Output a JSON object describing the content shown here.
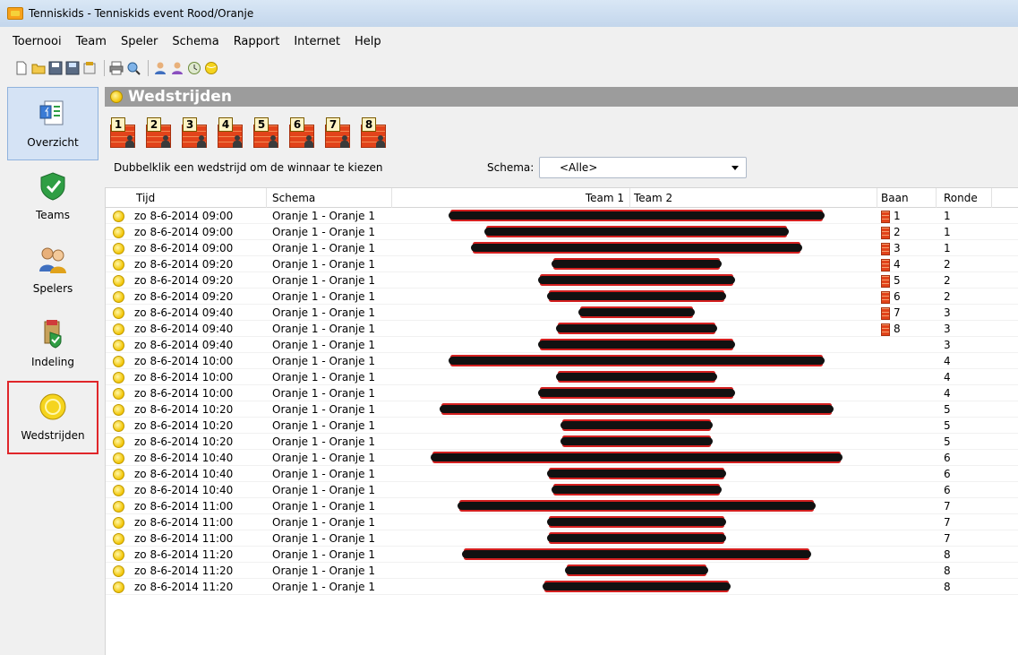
{
  "window": {
    "title": "Tenniskids - Tenniskids event Rood/Oranje"
  },
  "menu": [
    {
      "label": "Toernooi"
    },
    {
      "label": "Team"
    },
    {
      "label": "Speler"
    },
    {
      "label": "Schema"
    },
    {
      "label": "Rapport"
    },
    {
      "label": "Internet"
    },
    {
      "label": "Help"
    }
  ],
  "sidebar": {
    "items": [
      {
        "label": "Overzicht",
        "icon": "overview-icon",
        "active": true
      },
      {
        "label": "Teams",
        "icon": "shield-icon",
        "active": false
      },
      {
        "label": "Spelers",
        "icon": "players-icon",
        "active": false
      },
      {
        "label": "Indeling",
        "icon": "indeling-icon",
        "active": false
      },
      {
        "label": "Wedstrijden",
        "icon": "ball-icon",
        "active": false,
        "highlighted": true
      }
    ]
  },
  "panel": {
    "title": "Wedstrijden",
    "courts": [
      "1",
      "2",
      "3",
      "4",
      "5",
      "6",
      "7",
      "8"
    ],
    "hint": "Dubbelklik een wedstrijd om de winnaar te kiezen",
    "schema_label": "Schema:",
    "schema_value": "<Alle>"
  },
  "table": {
    "headers": {
      "tijd": "Tijd",
      "schema": "Schema",
      "team1": "Team 1",
      "team2": "Team 2",
      "baan": "Baan",
      "ronde": "Ronde"
    },
    "rows": [
      {
        "tijd": "zo 8-6-2014 09:00",
        "schema": "Oranje 1 - Oranje 1",
        "baan": "1",
        "ronde": "1",
        "redact_w": 420
      },
      {
        "tijd": "zo 8-6-2014 09:00",
        "schema": "Oranje 1 - Oranje 1",
        "baan": "2",
        "ronde": "1",
        "redact_w": 340
      },
      {
        "tijd": "zo 8-6-2014 09:00",
        "schema": "Oranje 1 - Oranje 1",
        "baan": "3",
        "ronde": "1",
        "redact_w": 370
      },
      {
        "tijd": "zo 8-6-2014 09:20",
        "schema": "Oranje 1 - Oranje 1",
        "baan": "4",
        "ronde": "2",
        "redact_w": 190
      },
      {
        "tijd": "zo 8-6-2014 09:20",
        "schema": "Oranje 1 - Oranje 1",
        "baan": "5",
        "ronde": "2",
        "redact_w": 220
      },
      {
        "tijd": "zo 8-6-2014 09:20",
        "schema": "Oranje 1 - Oranje 1",
        "baan": "6",
        "ronde": "2",
        "redact_w": 200
      },
      {
        "tijd": "zo 8-6-2014 09:40",
        "schema": "Oranje 1 - Oranje 1",
        "baan": "7",
        "ronde": "3",
        "redact_w": 130
      },
      {
        "tijd": "zo 8-6-2014 09:40",
        "schema": "Oranje 1 - Oranje 1",
        "baan": "8",
        "ronde": "3",
        "redact_w": 180
      },
      {
        "tijd": "zo 8-6-2014 09:40",
        "schema": "Oranje 1 - Oranje 1",
        "baan": "",
        "ronde": "3",
        "redact_w": 220
      },
      {
        "tijd": "zo 8-6-2014 10:00",
        "schema": "Oranje 1 - Oranje 1",
        "baan": "",
        "ronde": "4",
        "redact_w": 420
      },
      {
        "tijd": "zo 8-6-2014 10:00",
        "schema": "Oranje 1 - Oranje 1",
        "baan": "",
        "ronde": "4",
        "redact_w": 180
      },
      {
        "tijd": "zo 8-6-2014 10:00",
        "schema": "Oranje 1 - Oranje 1",
        "baan": "",
        "ronde": "4",
        "redact_w": 220
      },
      {
        "tijd": "zo 8-6-2014 10:20",
        "schema": "Oranje 1 - Oranje 1",
        "baan": "",
        "ronde": "5",
        "redact_w": 440
      },
      {
        "tijd": "zo 8-6-2014 10:20",
        "schema": "Oranje 1 - Oranje 1",
        "baan": "",
        "ronde": "5",
        "redact_w": 170
      },
      {
        "tijd": "zo 8-6-2014 10:20",
        "schema": "Oranje 1 - Oranje 1",
        "baan": "",
        "ronde": "5",
        "redact_w": 170
      },
      {
        "tijd": "zo 8-6-2014 10:40",
        "schema": "Oranje 1 - Oranje 1",
        "baan": "",
        "ronde": "6",
        "redact_w": 460
      },
      {
        "tijd": "zo 8-6-2014 10:40",
        "schema": "Oranje 1 - Oranje 1",
        "baan": "",
        "ronde": "6",
        "redact_w": 200
      },
      {
        "tijd": "zo 8-6-2014 10:40",
        "schema": "Oranje 1 - Oranje 1",
        "baan": "",
        "ronde": "6",
        "redact_w": 190
      },
      {
        "tijd": "zo 8-6-2014 11:00",
        "schema": "Oranje 1 - Oranje 1",
        "baan": "",
        "ronde": "7",
        "redact_w": 400
      },
      {
        "tijd": "zo 8-6-2014 11:00",
        "schema": "Oranje 1 - Oranje 1",
        "baan": "",
        "ronde": "7",
        "redact_w": 200
      },
      {
        "tijd": "zo 8-6-2014 11:00",
        "schema": "Oranje 1 - Oranje 1",
        "baan": "",
        "ronde": "7",
        "redact_w": 200
      },
      {
        "tijd": "zo 8-6-2014 11:20",
        "schema": "Oranje 1 - Oranje 1",
        "baan": "",
        "ronde": "8",
        "redact_w": 390
      },
      {
        "tijd": "zo 8-6-2014 11:20",
        "schema": "Oranje 1 - Oranje 1",
        "baan": "",
        "ronde": "8",
        "redact_w": 160
      },
      {
        "tijd": "zo 8-6-2014 11:20",
        "schema": "Oranje 1 - Oranje 1",
        "baan": "",
        "ronde": "8",
        "redact_w": 210
      }
    ]
  }
}
